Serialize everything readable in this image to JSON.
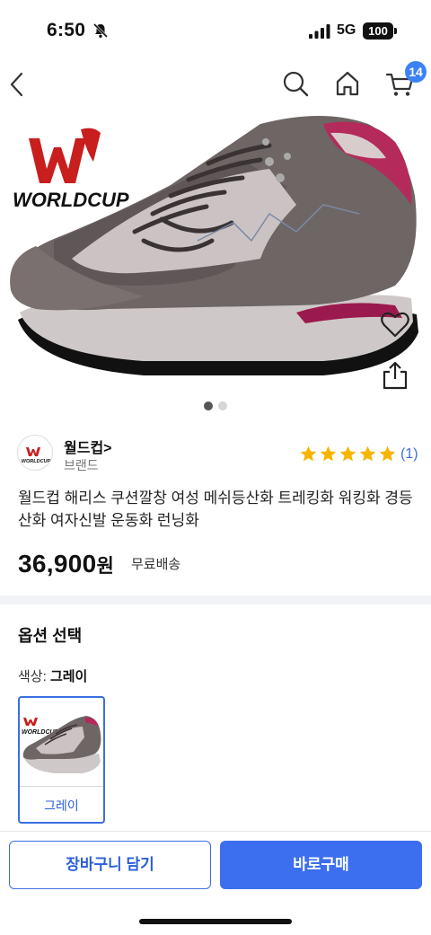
{
  "status_bar": {
    "time": "6:50",
    "network": "5G",
    "battery": "100",
    "icons": [
      "bell-slash-icon",
      "signal-icon",
      "battery-icon"
    ]
  },
  "nav": {
    "icons": [
      "chevron-left-icon",
      "search-icon",
      "home-icon",
      "cart-icon"
    ],
    "cart_count": "14"
  },
  "hero": {
    "image": "hiking-shoe-image",
    "logo_text": "WORLDCUP",
    "page_index": 1,
    "page_total": 2,
    "actions": [
      "heart-icon",
      "share-icon"
    ]
  },
  "brand": {
    "name": "월드컵",
    "chevron": ">",
    "type": "브랜드",
    "logo_text": "WORLDCUP"
  },
  "rating": {
    "stars": 5,
    "max_stars": 5,
    "count": "(1)",
    "star_color": "#f7b500"
  },
  "product": {
    "title": "월드컵 해리스 쿠션깔창 여성 메쉬등산화 트레킹화 워킹화 경등산화 여자신발 운동화 런닝화",
    "price": "36,900",
    "currency": "원",
    "shipping": "무료배송"
  },
  "options": {
    "title": "옵션 선택",
    "color_label": "색상:",
    "color_value": "그레이",
    "swatches": [
      {
        "label": "그레이",
        "selected": true,
        "logo_text": "WORLDCUP"
      }
    ]
  },
  "actions": {
    "cart_button": "장바구니 담기",
    "buy_button": "바로구매"
  },
  "colors": {
    "accent": "#3b6ff0",
    "badge": "#3b82f6",
    "divider": "#f1f3f6",
    "logo_red": "#c81e1e",
    "star": "#f7b500"
  }
}
